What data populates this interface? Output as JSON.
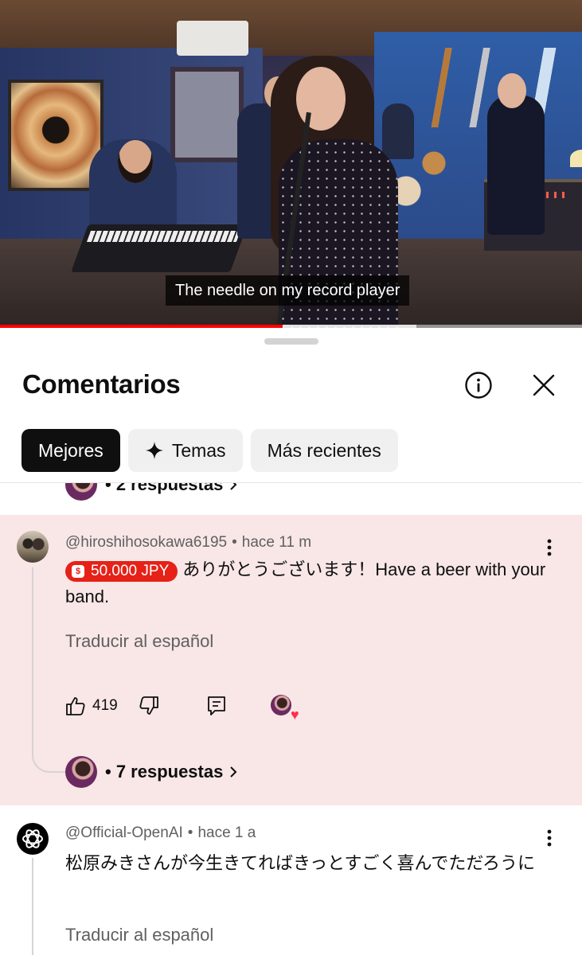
{
  "video": {
    "caption": "The needle on my record player",
    "progress": 0.485,
    "buffered": 0.715
  },
  "sheet": {
    "title": "Comentarios",
    "info_icon": "info-icon",
    "close_icon": "close-icon"
  },
  "chips": [
    {
      "label": "Mejores",
      "active": true
    },
    {
      "label": "Temas",
      "icon": "sparkle-icon"
    },
    {
      "label": "Más recientes"
    }
  ],
  "prev_thread": {
    "replies_label": "• 2 respuestas"
  },
  "comments": [
    {
      "author": "@hiroshihosokawa6195",
      "time": "hace 11 m",
      "superchat": "50.000 JPY",
      "text": "ありがとうございます！Have a beer with your band.",
      "translate": "Traducir al español",
      "likes": "419",
      "replies_label": "• 7 respuestas",
      "highlighted": true
    },
    {
      "author": "@Official-OpenAI",
      "time": "hace 1 a",
      "text": "松原みきさんが今生きてればきっとすごく喜んでただろうに",
      "translate": "Traducir al español"
    }
  ],
  "colors": {
    "highlight_bg": "#f9e6e6",
    "superchat_red": "#e62117",
    "progress_red": "#ff0000",
    "active_chip": "#0f0f0f",
    "chip_bg": "#f0f0f0",
    "secondary_text": "#606060"
  }
}
